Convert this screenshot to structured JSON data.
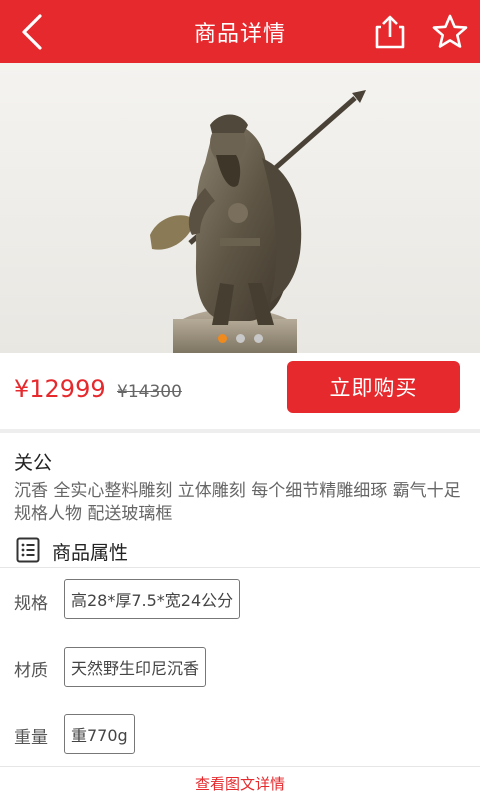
{
  "header": {
    "title": "商品详情",
    "back_icon": "back-chevron-icon",
    "share_icon": "share-icon",
    "favorite_icon": "star-icon",
    "bg_color": "#e6292d"
  },
  "gallery": {
    "image_subject": "bronze-colored statue of Guan Gong holding a guandao",
    "slide_count": 3,
    "active_slide": 1,
    "active_dot_color": "#ef8a1e"
  },
  "pricing": {
    "price": "¥12999",
    "original_price": "¥14300",
    "buy_label": "立即购买"
  },
  "product": {
    "name": "关公",
    "description": "沉香 全实心整料雕刻 立体雕刻 每个细节精雕细琢 霸气十足 规格人物 配送玻璃框"
  },
  "attributes": {
    "title": "商品属性",
    "icon": "list-icon",
    "items": [
      {
        "key": "规格",
        "value": "高28*厚7.5*宽24公分"
      },
      {
        "key": "材质",
        "value": "天然野生印尼沉香"
      },
      {
        "key": "重量",
        "value": "重770g"
      }
    ]
  },
  "footer": {
    "link_label": "查看图文详情"
  }
}
